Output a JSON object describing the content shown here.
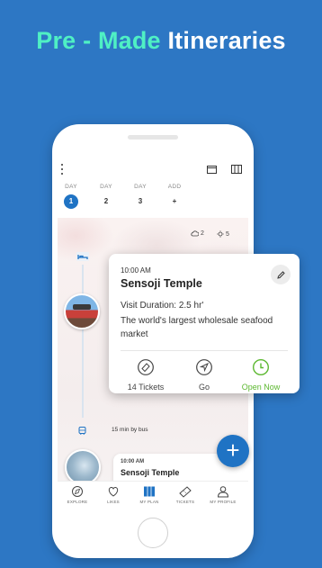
{
  "headline": {
    "part1": "Pre - Made",
    "part2": "Itineraries"
  },
  "colors": {
    "background": "#2d77c4",
    "accent": "#1f73c4",
    "headline_highlight": "#4ff0c4",
    "open_now": "#5cb830"
  },
  "days": [
    {
      "label": "DAY",
      "value": "1",
      "active": true
    },
    {
      "label": "DAY",
      "value": "2",
      "active": false
    },
    {
      "label": "DAY",
      "value": "3",
      "active": false
    },
    {
      "label": "ADD",
      "value": "+",
      "active": false
    }
  ],
  "weather": {
    "cloud": "2",
    "temp": "5"
  },
  "route": {
    "transport": "15 min by bus"
  },
  "stop": {
    "time": "10:00 AM",
    "name": "Sensoji Temple",
    "duration": "Visit Duration: 2.5 hr'",
    "description": "The world's largest wholesale seafood market"
  },
  "actions": [
    {
      "icon": "ticket-icon",
      "label": "14 Tickets"
    },
    {
      "icon": "navigation-icon",
      "label": "Go"
    },
    {
      "icon": "clock-icon",
      "label": "Open Now"
    }
  ],
  "next_stop": {
    "time": "10:00 AM",
    "name": "Sensoji Temple"
  },
  "tabs": [
    {
      "icon": "compass-icon",
      "label": "EXPLORE"
    },
    {
      "icon": "heart-icon",
      "label": "LIKES"
    },
    {
      "icon": "map-icon",
      "label": "MY PLAN"
    },
    {
      "icon": "ticket-icon",
      "label": "TICKETS"
    },
    {
      "icon": "user-icon",
      "label": "MY PROFILE"
    }
  ]
}
